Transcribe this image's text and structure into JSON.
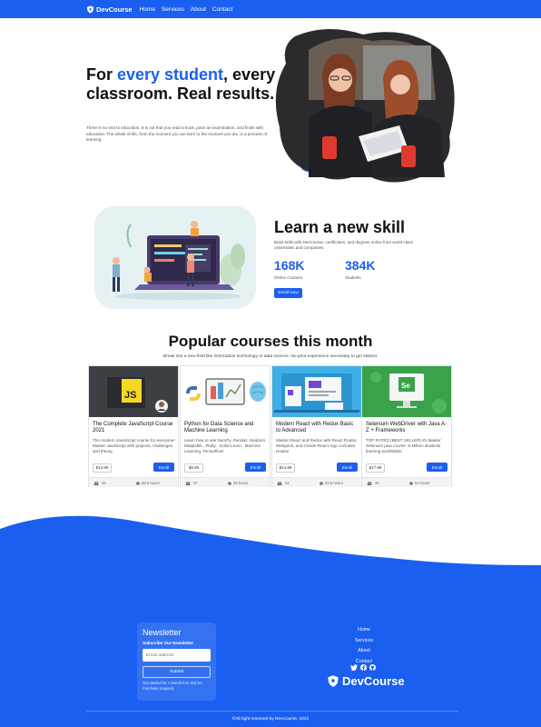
{
  "nav": {
    "brand": "DevCourse",
    "links": [
      "Home",
      "Services",
      "About",
      "Contact"
    ]
  },
  "hero": {
    "title_pre": "For ",
    "title_accent": "every student",
    "title_post": ", every classroom. Real results.",
    "text": "There is no end to education. It is not that you read a book, pass an examination, and finish with education. The whole of life, from the moment you are born to the moment you die, is a process of learning."
  },
  "skill": {
    "title": "Learn a new skill",
    "text": "Build skills with DevCourse, certificates, and degrees online from world-class universities and companies.",
    "stats": [
      {
        "value": "168K",
        "label": "Online Courses"
      },
      {
        "value": "384K",
        "label": "Students"
      }
    ],
    "button": "Enroll now"
  },
  "popular": {
    "title": "Popular courses this month",
    "subtitle": "Break into a new field like information technology or data science. No prior experience necessary to get started.",
    "courses": [
      {
        "title": "The Complete JavaScript Course 2021",
        "desc": "The modern JavaScript course for everyone! Master JavaScript with projects, challenges and theory.",
        "price": "$13.99",
        "button": "Enroll",
        "students": "32",
        "hours": "68.5 hours"
      },
      {
        "title": "Python for Data Science and Machine Learning",
        "desc": "Learn how to use NumPy, Pandas, Seaborn , Matplotlib , Plotly , Scikit-Learn , Machine Learning, Tensorflow!",
        "price": "$9.99",
        "button": "Enroll",
        "students": "37",
        "hours": "25 hours"
      },
      {
        "title": "Modern React with Redux Basic to Advanced",
        "desc": "Master React and Redux with React Router, Webpack, and Create-React-App. Includes Hooks!",
        "price": "$14.99",
        "button": "Enroll",
        "students": "32",
        "hours": "52.5 hours"
      },
      {
        "title": "Selenium WebDriver with Java A-Z + Frameworks",
        "desc": "TOP RATED (BEST SELLER) #1 Master Selenium java course -5 Million students learning worldWide.",
        "price": "$17.99",
        "button": "Enroll",
        "students": "40",
        "hours": "54 hours"
      }
    ]
  },
  "newsletter": {
    "title": "Newsletter",
    "subtitle": "Subscribe Our Newsletter",
    "placeholder": "Email address",
    "button": "Submit",
    "note": "Get started for 1 Month free trial No Purchase required."
  },
  "footer": {
    "links": [
      "Home",
      "Services",
      "About",
      "Contact"
    ],
    "social_icons": [
      "twitter-icon",
      "facebook-icon",
      "github-icon"
    ],
    "brand": "DevCourse",
    "copyright": "©All right reserved by DevCourse, 2021"
  },
  "colors": {
    "primary": "#1a5ff0",
    "text": "#111111"
  }
}
